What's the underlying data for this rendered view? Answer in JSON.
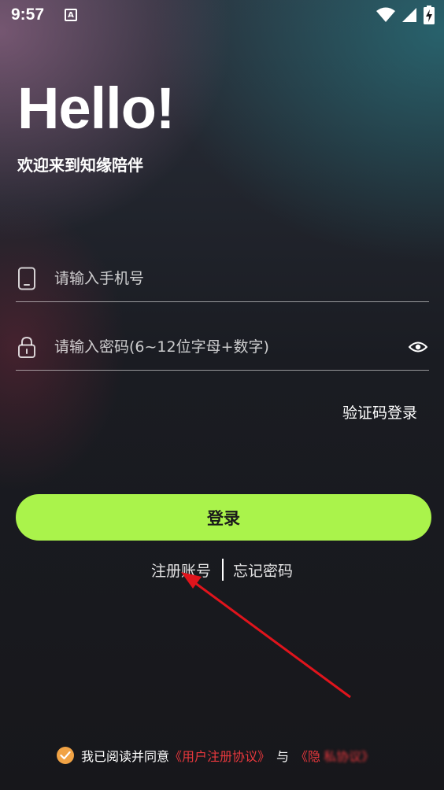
{
  "status_bar": {
    "time": "9:57",
    "notification_icon": "A",
    "icons": [
      "wifi-icon",
      "signal-icon",
      "battery-charging-icon"
    ]
  },
  "header": {
    "title": "Hello!",
    "subtitle": "欢迎来到知缘陪伴"
  },
  "form": {
    "phone": {
      "placeholder": "请输入手机号",
      "value": "",
      "icon": "phone-icon"
    },
    "password": {
      "placeholder": "请输入密码(6~12位字母+数字)",
      "value": "",
      "icon": "lock-icon",
      "toggle_icon": "eye-icon"
    },
    "sms_login_label": "验证码登录",
    "login_label": "登录"
  },
  "links": {
    "register": "注册账号",
    "forgot": "忘记密码"
  },
  "agreement": {
    "prefix": "我已阅读并同意",
    "user_agreement": "《用户注册协议》",
    "and": "与",
    "privacy_partial": "《隐",
    "privacy_obscured": "私协议》",
    "checked": true
  },
  "colors": {
    "accent": "#aaf34b",
    "link_red": "#e8383d",
    "check_orange": "#f1a345",
    "background": "#17171b",
    "annotation_arrow": "#e0141c"
  }
}
